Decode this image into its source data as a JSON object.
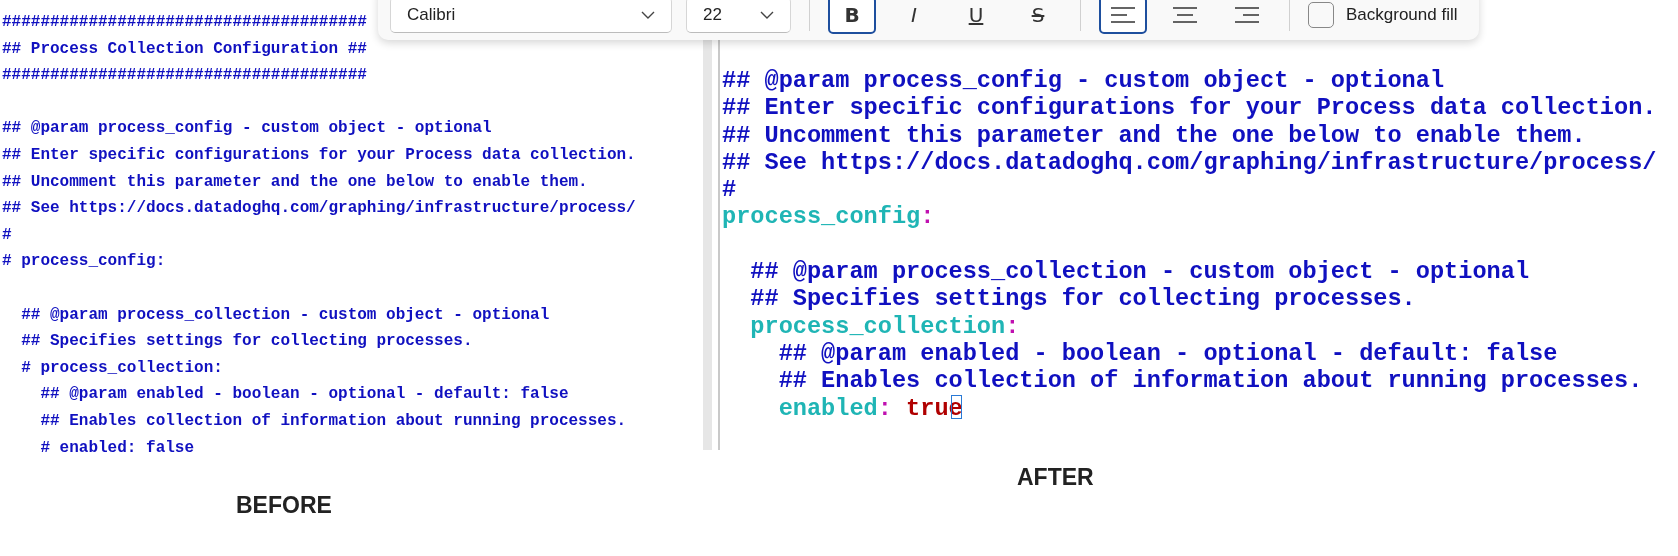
{
  "toolbar": {
    "font": "Calibri",
    "size": "22",
    "styles": [
      {
        "kind": "bold",
        "label": "B",
        "selected": true
      },
      {
        "kind": "italic",
        "label": "I",
        "selected": false
      },
      {
        "kind": "underline",
        "label": "U",
        "selected": false
      },
      {
        "kind": "strikethrough",
        "label": "S",
        "selected": false
      }
    ],
    "align": [
      {
        "kind": "left",
        "selected": true
      },
      {
        "kind": "center",
        "selected": false
      },
      {
        "kind": "right",
        "selected": false
      }
    ],
    "background_fill": {
      "label": "Background fill",
      "checked": false
    }
  },
  "before": {
    "caption": "BEFORE",
    "blocks": [
      [
        [
          {
            "kind": "comment",
            "text": "######################################"
          }
        ],
        [
          {
            "kind": "comment",
            "text": "## Process Collection Configuration ##"
          }
        ],
        [
          {
            "kind": "comment",
            "text": "######################################"
          }
        ]
      ],
      [
        [
          {
            "kind": "comment",
            "text": "## @param process_config - custom object - optional"
          }
        ],
        [
          {
            "kind": "comment",
            "text": "## Enter specific configurations for your Process data collection."
          }
        ],
        [
          {
            "kind": "comment",
            "text": "## Uncomment this parameter and the one below to enable them."
          }
        ],
        [
          {
            "kind": "comment",
            "text": "## See https://docs.datadoghq.com/graphing/infrastructure/process/"
          }
        ],
        [
          {
            "kind": "comment",
            "text": "#"
          }
        ],
        [
          {
            "kind": "comment",
            "text": "# process_config:"
          }
        ]
      ],
      [
        [
          {
            "kind": "comment",
            "text": "  ## @param process_collection - custom object - optional"
          }
        ],
        [
          {
            "kind": "comment",
            "text": "  ## Specifies settings for collecting processes."
          }
        ],
        [
          {
            "kind": "comment",
            "text": "  # process_collection:"
          }
        ],
        [
          {
            "kind": "comment",
            "text": "    ## @param enabled - boolean - optional - default: false"
          }
        ],
        [
          {
            "kind": "comment",
            "text": "    ## Enables collection of information about running processes."
          }
        ],
        [
          {
            "kind": "comment",
            "text": "    # enabled: false"
          }
        ]
      ]
    ]
  },
  "after": {
    "caption": "AFTER",
    "blocks": [
      [
        [
          {
            "kind": "comment",
            "text": "## @param process_config - custom object - optional"
          }
        ],
        [
          {
            "kind": "comment",
            "text": "## Enter specific configurations for your Process data collection."
          }
        ],
        [
          {
            "kind": "comment",
            "text": "## Uncomment this parameter and the one below to enable them."
          }
        ],
        [
          {
            "kind": "comment",
            "text": "## See https://docs.datadoghq.com/graphing/infrastructure/process/"
          }
        ],
        [
          {
            "kind": "comment",
            "text": "#"
          }
        ],
        [
          {
            "kind": "key",
            "text": "process_config"
          },
          {
            "kind": "colon",
            "text": ":"
          }
        ]
      ],
      [
        [
          {
            "kind": "comment",
            "text": "  ## @param process_collection - custom object - optional"
          }
        ],
        [
          {
            "kind": "comment",
            "text": "  ## Specifies settings for collecting processes."
          }
        ],
        [
          {
            "kind": "key",
            "text": "  process_collection"
          },
          {
            "kind": "colon",
            "text": ":"
          }
        ],
        [
          {
            "kind": "comment",
            "text": "    ## @param enabled - boolean - optional - default: false"
          }
        ],
        [
          {
            "kind": "comment",
            "text": "    ## Enables collection of information about running processes."
          }
        ],
        [
          {
            "kind": "key",
            "text": "    enabled"
          },
          {
            "kind": "colon",
            "text": ":"
          },
          {
            "kind": "value",
            "text": " true",
            "cursor": true
          }
        ]
      ]
    ]
  }
}
